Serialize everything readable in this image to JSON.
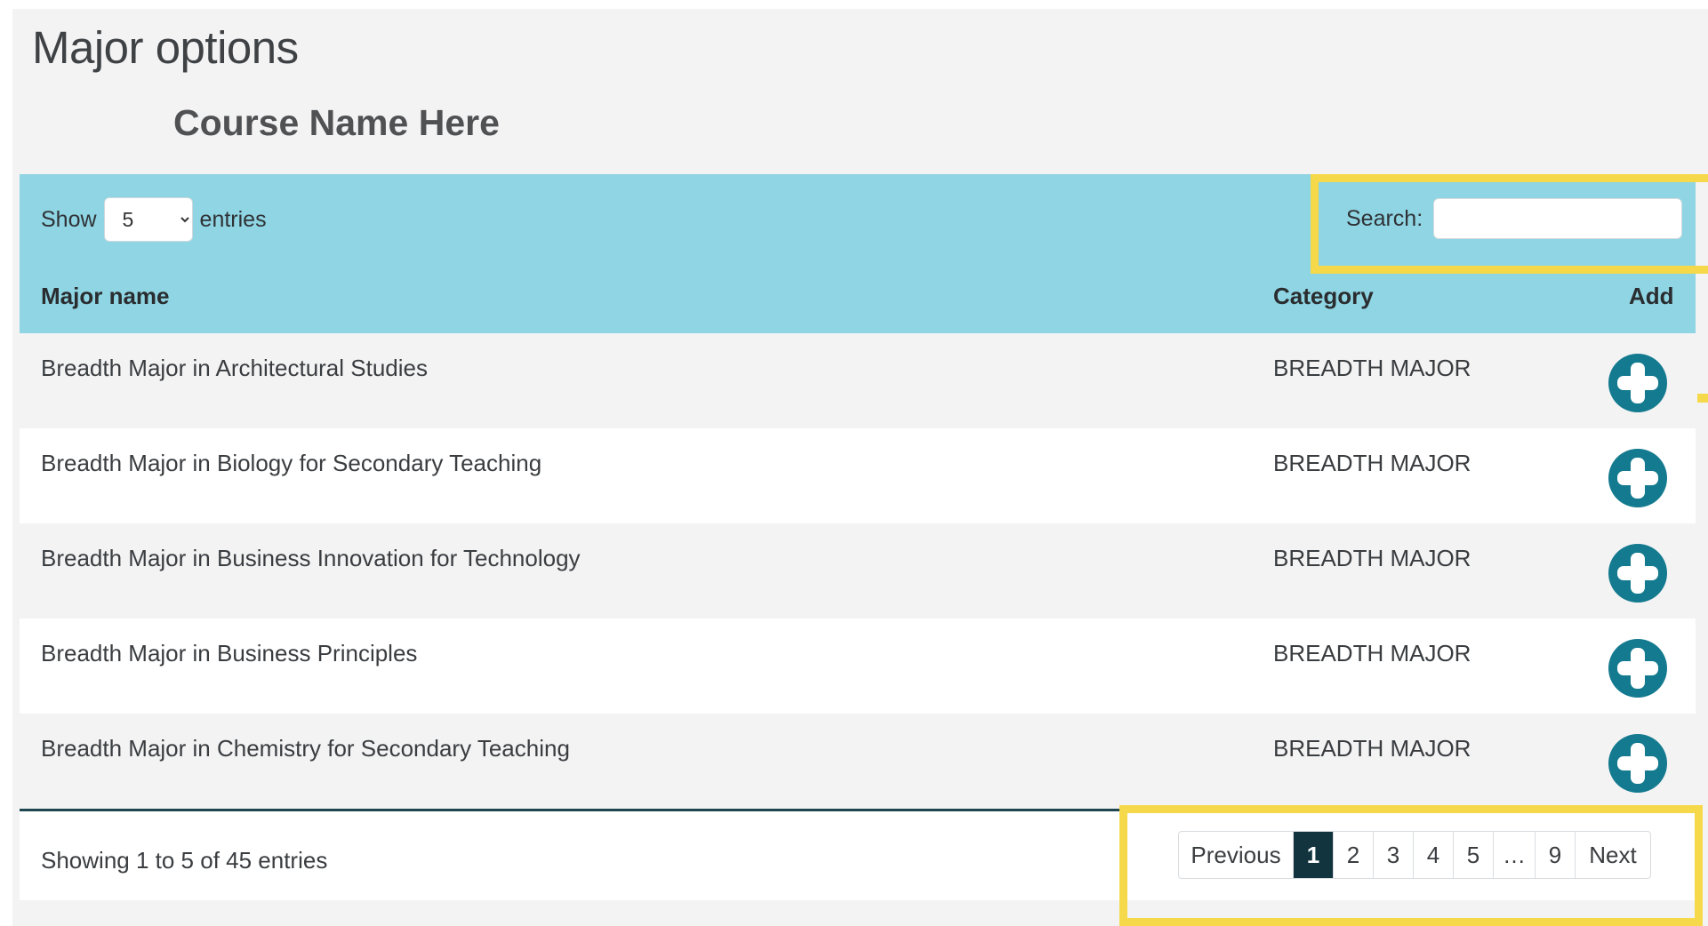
{
  "page_title": "Major options",
  "course_name": "Course Name Here",
  "length": {
    "show_label": "Show",
    "selected": "5",
    "entries_label": "entries"
  },
  "search": {
    "label": "Search:",
    "value": ""
  },
  "table": {
    "headers": {
      "name": "Major name",
      "category": "Category",
      "add": "Add"
    },
    "rows": [
      {
        "name": "Breadth Major in Architectural Studies",
        "category": "BREADTH MAJOR"
      },
      {
        "name": "Breadth Major in Biology for Secondary Teaching",
        "category": "BREADTH MAJOR"
      },
      {
        "name": "Breadth Major in Business Innovation for Technology",
        "category": "BREADTH MAJOR"
      },
      {
        "name": "Breadth Major in Business Principles",
        "category": "BREADTH MAJOR"
      },
      {
        "name": "Breadth Major in Chemistry for Secondary Teaching",
        "category": "BREADTH MAJOR"
      }
    ],
    "add_icon": "plus-circle-icon"
  },
  "info": "Showing 1 to 5 of 45 entries",
  "pagination": {
    "previous": "Previous",
    "pages": [
      "1",
      "2",
      "3",
      "4",
      "5",
      "…",
      "9"
    ],
    "active": "1",
    "next": "Next"
  },
  "colors": {
    "header_bg": "#8fd5e3",
    "add_icon": "#147a8f",
    "active_page": "#12343f",
    "highlight": "#f6d94a",
    "page_bg": "#f3f3f4"
  }
}
